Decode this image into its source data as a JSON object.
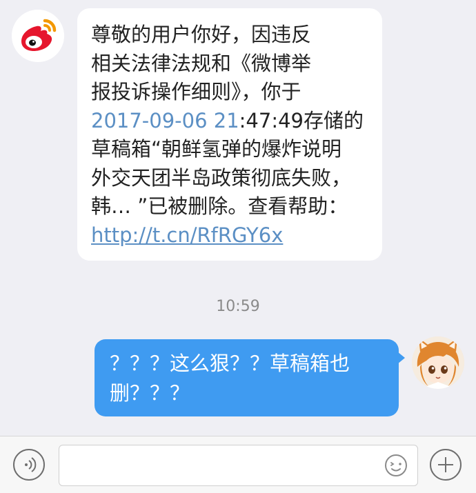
{
  "messages": [
    {
      "sender": "weibo-official",
      "avatar_icon": "weibo-logo-icon",
      "lines": [
        "尊敬的用户你好，因违反",
        "相关法律法规和《微博举",
        "报投诉操作细则》，你于"
      ],
      "date_part": "2017-09-06 21",
      "date_rest": ":47:49存储的",
      "lines_after": [
        "草稿箱“朝鲜氢弹的爆炸说明",
        "外交天团半岛政策彻底失败，",
        "韩… ”已被删除。查看帮助："
      ],
      "link": "http://t.cn/RfRGY6x"
    },
    {
      "sender": "me",
      "avatar_icon": "anime-girl-avatar-icon",
      "lines": [
        "？？？这么狠？？草稿箱也",
        "删？？？"
      ]
    }
  ],
  "timestamp": "10:59",
  "composer": {
    "input_value": "",
    "voice_icon": "voice-icon",
    "emoji_icon": "emoji-icon",
    "add_icon": "plus-icon"
  },
  "colors": {
    "background": "#efeff4",
    "outgoing_bubble": "#3f9bf1",
    "link": "#5b8fc4",
    "weibo_red": "#e6162d",
    "weibo_orange": "#f39800"
  }
}
